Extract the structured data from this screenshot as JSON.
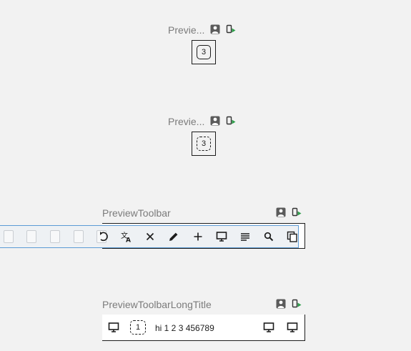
{
  "previews": [
    {
      "title": "Previe...",
      "badge": "3"
    },
    {
      "title": "Previe...",
      "badge": "3"
    },
    {
      "title": "PreviewToolbar"
    },
    {
      "title": "PreviewToolbarLongTitle"
    }
  ],
  "toolbar_icons": [
    "refresh-icon",
    "translate-icon",
    "close-icon",
    "pencil-icon",
    "plus-icon",
    "monitor-icon",
    "list-icon",
    "search-icon",
    "copy-icon"
  ],
  "long_toolbar": {
    "badge": "1",
    "text": "hi 1 2 3 456789"
  },
  "colors": {
    "background": "#f2f2f2",
    "accent_green": "#2e9e4a",
    "toolbar_highlight": "#5b9bd5",
    "title_gray": "#7b7b7b"
  }
}
